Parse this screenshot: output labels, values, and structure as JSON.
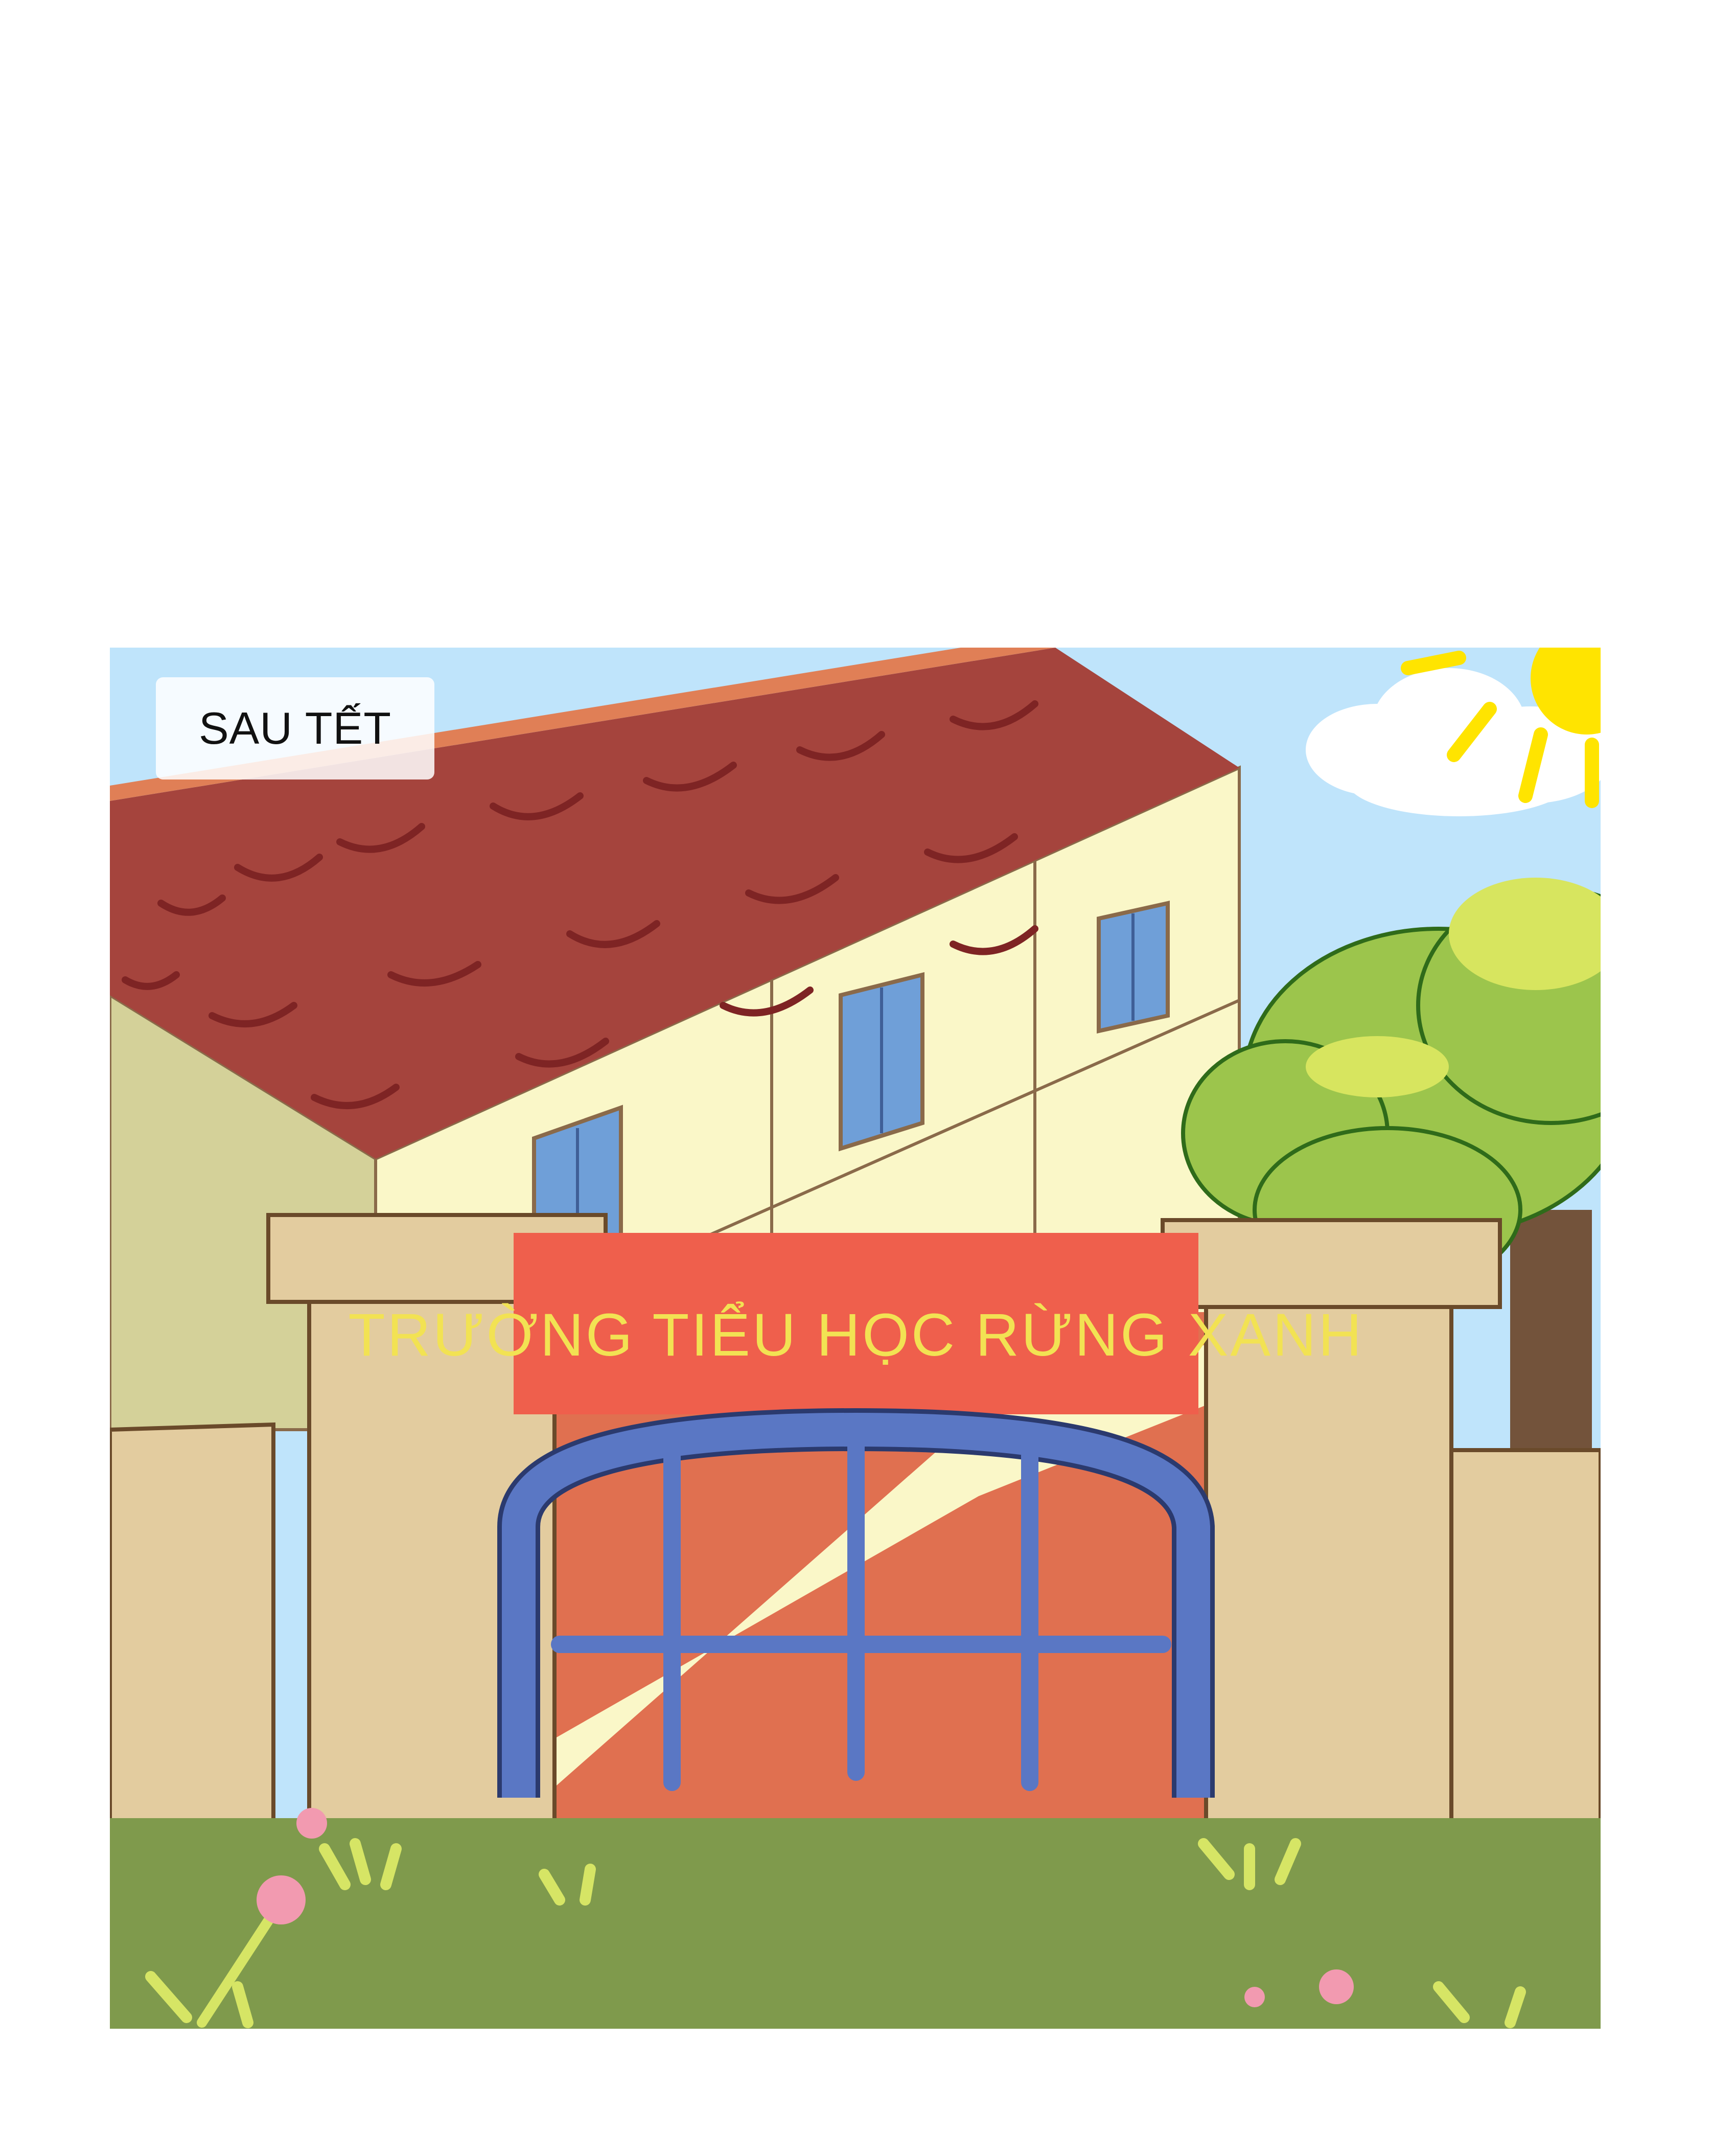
{
  "panel": {
    "caption": "SAU TẾT",
    "sign_text": "TRƯỜNG TIỂU HỌC RỪNG XANH"
  },
  "palette": {
    "sky": "#bfe4fb",
    "roof": "#a5443d",
    "roof_line": "#7e2424",
    "wall": "#faf7c8",
    "side_wall": "#d4d199",
    "window": "#6f9fd8",
    "pillar": "#e3cc9f",
    "sign": "#ef5f4c",
    "sign_text": "#f2e253",
    "gate": "#5a77c4",
    "grass": "#7f9a4c",
    "tree": "#9cc54c",
    "trunk": "#73533b",
    "sun": "#ffe400",
    "flower": "#f29ab0"
  }
}
